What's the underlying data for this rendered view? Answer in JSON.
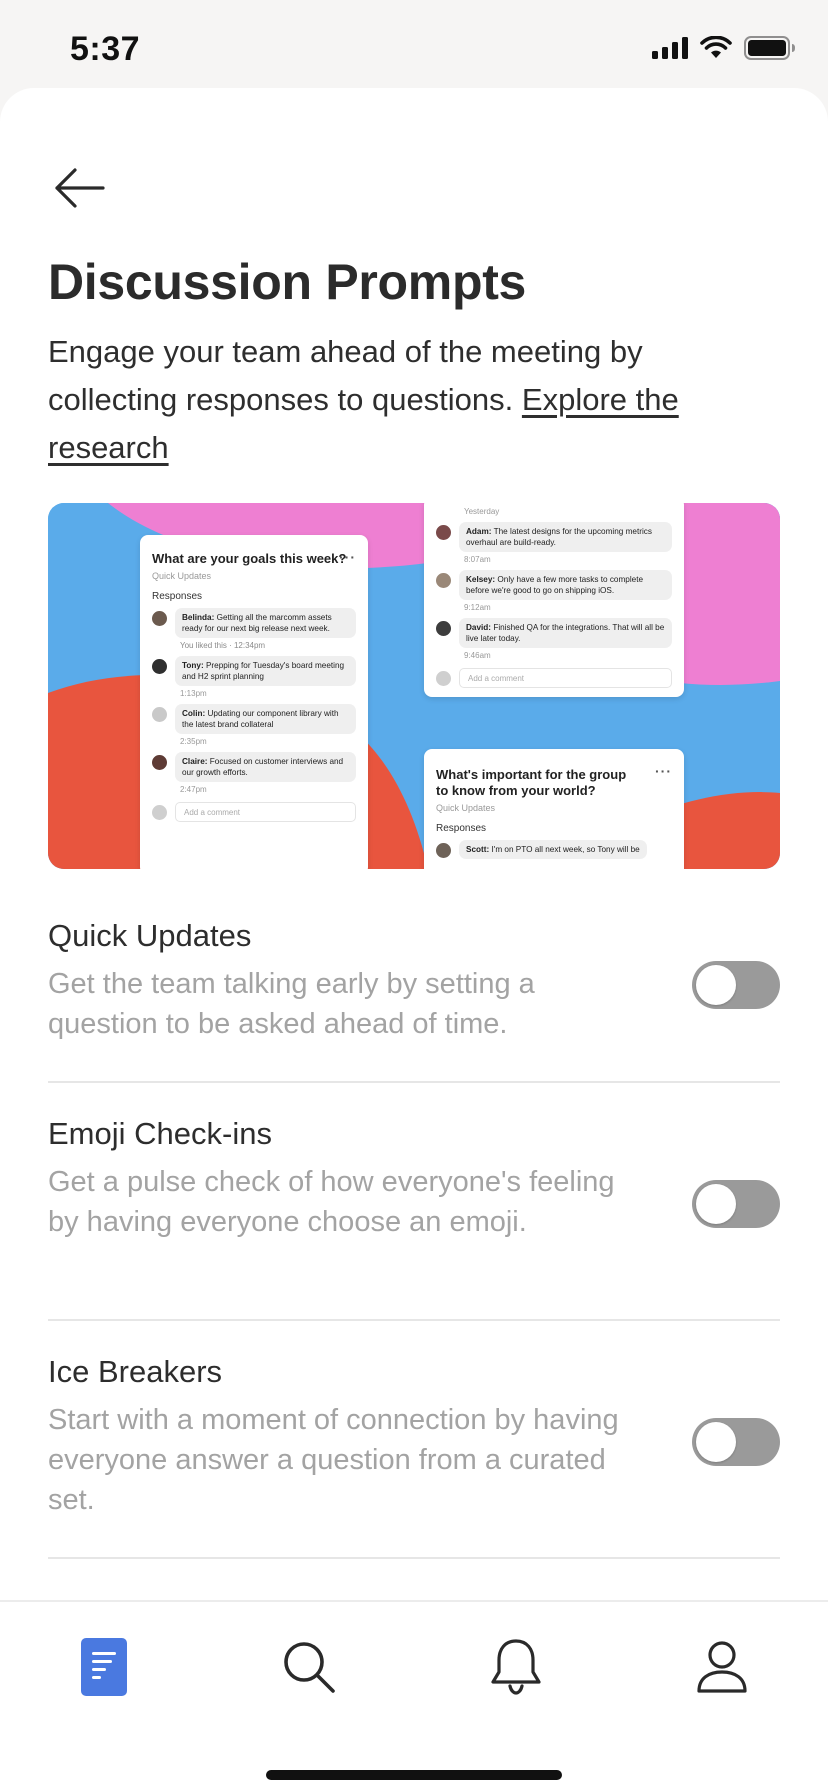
{
  "status": {
    "time": "5:37"
  },
  "header": {
    "title": "Discussion Prompts",
    "description": "Engage your team ahead of the meeting by collecting responses to questions.",
    "link_text": "Explore the research"
  },
  "hero": {
    "card1": {
      "title": "What are your goals this week?",
      "subtitle": "Quick Updates",
      "responses_label": "Responses",
      "comments": [
        {
          "name": "Belinda:",
          "text": "Getting all the marcomm assets ready for our next big release next week.",
          "meta": "You liked this · 12:34pm"
        },
        {
          "name": "Tony:",
          "text": "Prepping for Tuesday's board meeting and H2 sprint planning",
          "meta": "1:13pm"
        },
        {
          "name": "Colin:",
          "text": "Updating our component library with the latest brand collateral",
          "meta": "2:35pm"
        },
        {
          "name": "Claire:",
          "text": "Focused on customer interviews and our growth efforts.",
          "meta": "2:47pm"
        }
      ],
      "input_placeholder": "Add a comment"
    },
    "card2": {
      "top_meta": "Yesterday",
      "comments": [
        {
          "name": "Adam:",
          "text": "The latest designs for the upcoming metrics overhaul are build-ready.",
          "meta": "8:07am"
        },
        {
          "name": "Kelsey:",
          "text": "Only have a few more tasks to complete before we're good to go on shipping iOS.",
          "meta": "9:12am"
        },
        {
          "name": "David:",
          "text": "Finished QA for the integrations. That will all be live later today.",
          "meta": "9:46am"
        }
      ],
      "input_placeholder": "Add a comment"
    },
    "card3": {
      "title": "What's important for the group to know from your world?",
      "subtitle": "Quick Updates",
      "responses_label": "Responses",
      "comment": {
        "name": "Scott:",
        "text": "I'm on PTO all next week, so Tony will be"
      }
    }
  },
  "settings": [
    {
      "title": "Quick Updates",
      "description": "Get the team talking early by setting a question to be asked ahead of time.",
      "enabled": false
    },
    {
      "title": "Emoji Check-ins",
      "description": "Get a pulse check of how everyone's feeling by having everyone choose an emoji.",
      "enabled": false
    },
    {
      "title": "Ice Breakers",
      "description": "Start with a moment of connection by having everyone answer a question from a curated set.",
      "enabled": false
    }
  ],
  "tabs": [
    {
      "icon": "document-icon",
      "active": true
    },
    {
      "icon": "search-icon",
      "active": false
    },
    {
      "icon": "bell-icon",
      "active": false
    },
    {
      "icon": "profile-icon",
      "active": false
    }
  ],
  "colors": {
    "accent": "#4a79e0",
    "toggle_off": "#9a9a9a",
    "hero_pink": "#ee7fd2",
    "hero_blue": "#5aabea",
    "hero_red": "#e8553e"
  }
}
